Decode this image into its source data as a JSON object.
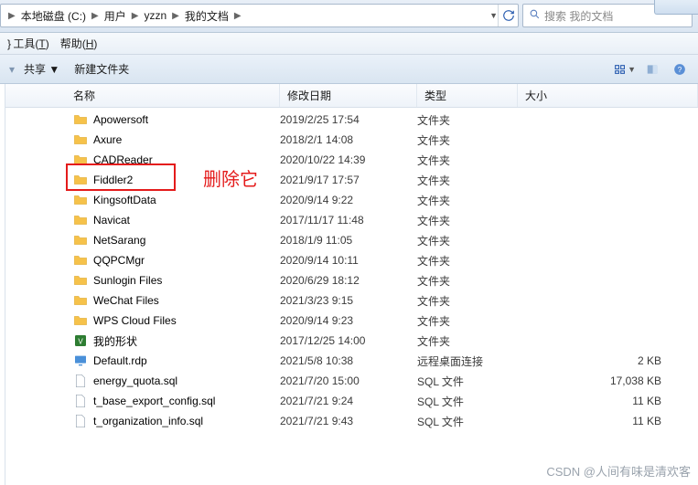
{
  "breadcrumb": {
    "items": [
      "本地磁盘 (C:)",
      "用户",
      "yzzn",
      "我的文档"
    ]
  },
  "search": {
    "placeholder": "搜索 我的文档"
  },
  "menu": {
    "tools_prefix": "工具(",
    "tools_u": "T",
    "tools_suffix": ")",
    "help_prefix": "帮助(",
    "help_u": "H",
    "help_suffix": ")"
  },
  "toolbar": {
    "share": "共享 ▼",
    "newfolder": "新建文件夹"
  },
  "columns": {
    "name": "名称",
    "date": "修改日期",
    "type": "类型",
    "size": "大小"
  },
  "rows": [
    {
      "name": "Apowersoft",
      "date": "2019/2/25 17:54",
      "type": "文件夹",
      "size": "",
      "icon": "folder"
    },
    {
      "name": "Axure",
      "date": "2018/2/1 14:08",
      "type": "文件夹",
      "size": "",
      "icon": "folder"
    },
    {
      "name": "CADReader",
      "date": "2020/10/22 14:39",
      "type": "文件夹",
      "size": "",
      "icon": "folder"
    },
    {
      "name": "Fiddler2",
      "date": "2021/9/17 17:57",
      "type": "文件夹",
      "size": "",
      "icon": "folder"
    },
    {
      "name": "KingsoftData",
      "date": "2020/9/14 9:22",
      "type": "文件夹",
      "size": "",
      "icon": "folder"
    },
    {
      "name": "Navicat",
      "date": "2017/11/17 11:48",
      "type": "文件夹",
      "size": "",
      "icon": "folder"
    },
    {
      "name": "NetSarang",
      "date": "2018/1/9 11:05",
      "type": "文件夹",
      "size": "",
      "icon": "folder"
    },
    {
      "name": "QQPCMgr",
      "date": "2020/9/14 10:11",
      "type": "文件夹",
      "size": "",
      "icon": "folder"
    },
    {
      "name": "Sunlogin Files",
      "date": "2020/6/29 18:12",
      "type": "文件夹",
      "size": "",
      "icon": "folder"
    },
    {
      "name": "WeChat Files",
      "date": "2021/3/23 9:15",
      "type": "文件夹",
      "size": "",
      "icon": "folder"
    },
    {
      "name": "WPS Cloud Files",
      "date": "2020/9/14 9:23",
      "type": "文件夹",
      "size": "",
      "icon": "folder"
    },
    {
      "name": "我的形状",
      "date": "2017/12/25 14:00",
      "type": "文件夹",
      "size": "",
      "icon": "excel"
    },
    {
      "name": "Default.rdp",
      "date": "2021/5/8 10:38",
      "type": "远程桌面连接",
      "size": "2 KB",
      "icon": "rdp"
    },
    {
      "name": "energy_quota.sql",
      "date": "2021/7/20 15:00",
      "type": "SQL 文件",
      "size": "17,038 KB",
      "icon": "file"
    },
    {
      "name": "t_base_export_config.sql",
      "date": "2021/7/21 9:24",
      "type": "SQL 文件",
      "size": "11 KB",
      "icon": "file"
    },
    {
      "name": "t_organization_info.sql",
      "date": "2021/7/21 9:43",
      "type": "SQL 文件",
      "size": "11 KB",
      "icon": "file"
    }
  ],
  "annotation": {
    "text": "删除它"
  },
  "watermark": "CSDN @人间有味是清欢客"
}
